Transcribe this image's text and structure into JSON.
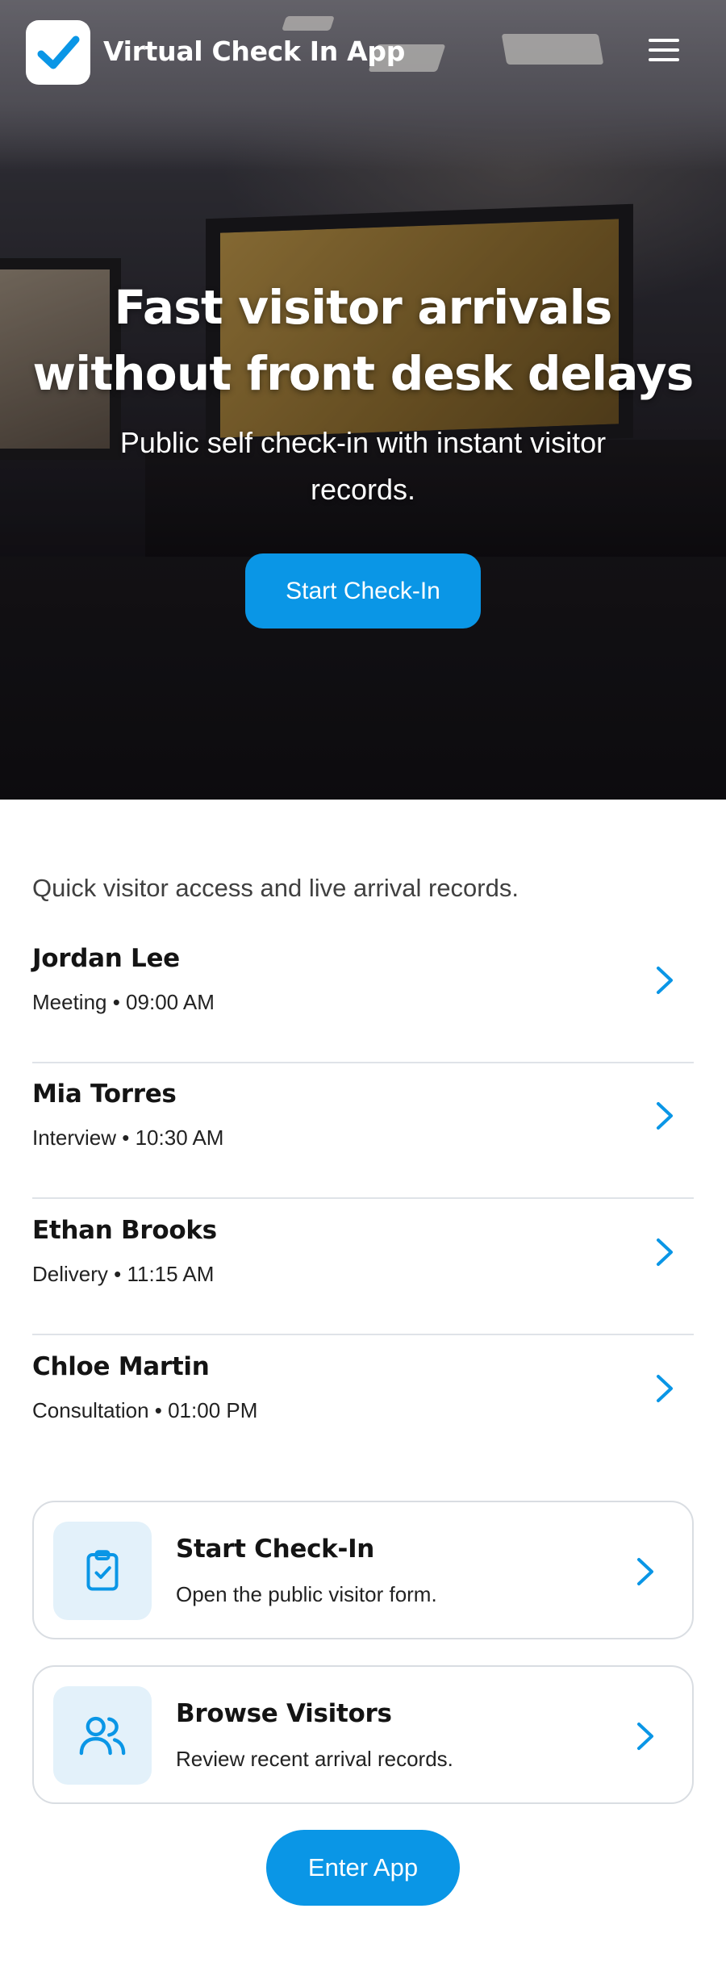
{
  "app": {
    "title": "Virtual Check In App",
    "logo_icon": "checkmark-icon",
    "menu_icon": "hamburger-menu-icon"
  },
  "hero": {
    "title_line1": "Fast visitor arrivals",
    "title_line2": "without front desk delays",
    "subtitle": "Public self check-in with instant visitor records.",
    "cta_label": "Start Check-In"
  },
  "intro": "Quick visitor access and live arrival records.",
  "visitors": [
    {
      "name": "Jordan Lee",
      "meta": "Meeting • 09:00 AM"
    },
    {
      "name": "Mia Torres",
      "meta": "Interview • 10:30 AM"
    },
    {
      "name": "Ethan Brooks",
      "meta": "Delivery • 11:15 AM"
    },
    {
      "name": "Chloe Martin",
      "meta": "Consultation • 01:00 PM"
    }
  ],
  "cards": [
    {
      "title": "Start Check-In",
      "subtitle": "Open the public visitor form.",
      "icon": "clipboard-check-icon"
    },
    {
      "title": "Browse Visitors",
      "subtitle": "Review recent arrival records.",
      "icon": "users-icon"
    }
  ],
  "enter_button": "Enter App",
  "colors": {
    "accent": "#0a96e6",
    "icon_bg": "#e3f1fa",
    "divider": "#dfe3e8",
    "text": "#141414"
  }
}
